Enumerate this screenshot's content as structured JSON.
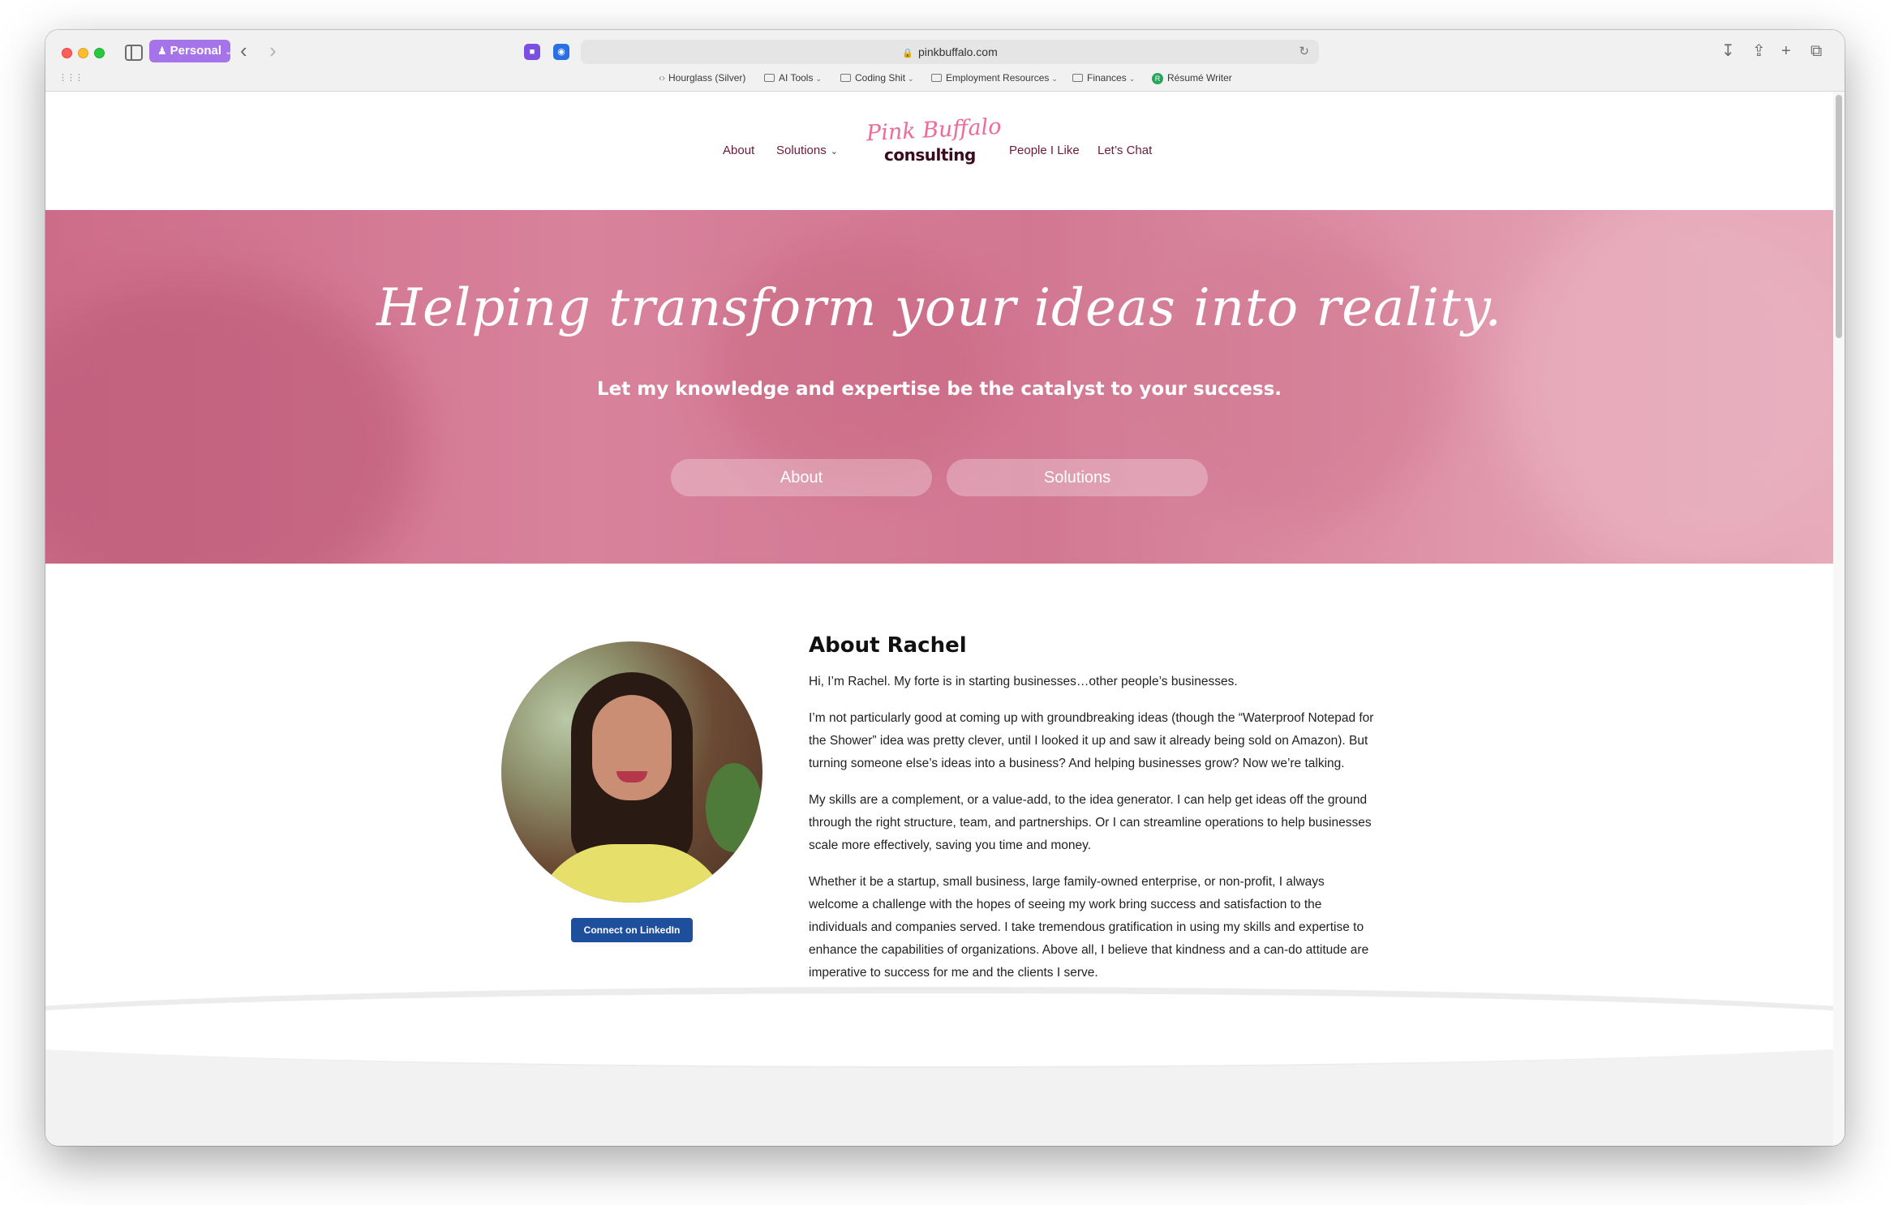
{
  "browser": {
    "profile_label": "Personal",
    "url": "pinkbuffalo.com",
    "bookmarks": [
      {
        "label": "Hourglass (Silver)"
      },
      {
        "label": "AI Tools"
      },
      {
        "label": "Coding Shit"
      },
      {
        "label": "Employment Resources"
      },
      {
        "label": "Finances"
      },
      {
        "label": "Résumé Writer"
      }
    ]
  },
  "nav": {
    "about": "About",
    "solutions": "Solutions",
    "people": "People I Like",
    "chat": "Let’s Chat"
  },
  "logo": {
    "script": "Pink Buffalo",
    "word": "consulting"
  },
  "hero": {
    "title": "Helping transform your ideas into reality.",
    "subtitle": "Let my knowledge and expertise be the catalyst to your success.",
    "btn_about": "About",
    "btn_solutions": "Solutions"
  },
  "about": {
    "heading": "About Rachel",
    "linkedin_label": "Connect on LinkedIn",
    "paragraphs": [
      "Hi, I’m Rachel. My forte is in starting businesses…other people’s businesses.",
      "I’m not particularly good at coming up with groundbreaking ideas (though the “Waterproof Notepad for the Shower” idea was pretty clever, until I looked it up and saw it already being sold on Amazon). But turning someone else’s ideas into a business? And helping businesses grow? Now we’re talking.",
      "My skills are a complement, or a value-add, to the idea generator. I can help get ideas off the ground through the right structure, team, and partnerships. Or I can streamline operations to help businesses scale more effectively, saving you time and money.",
      "Whether it be a startup, small business, large family-owned enterprise, or non-profit, I always welcome a challenge with the hopes of seeing my work bring success and satisfaction to the individuals and companies served. I take tremendous gratification in using my skills and expertise to enhance the capabilities of organizations. Above all, I believe that kindness and a can-do attitude are imperative to success for me and the clients I serve."
    ]
  },
  "colors": {
    "nav_text": "#6c1a3a",
    "hero_pink": "#d07b95",
    "linkedin_blue": "#1e4f9c",
    "profile_purple": "#a574e8"
  }
}
